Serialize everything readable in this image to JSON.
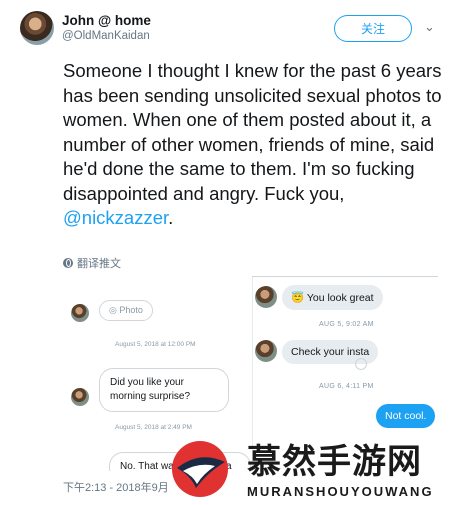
{
  "tweet": {
    "display_name": "John @ home",
    "handle": "@OldManKaidan",
    "follow_label": "关注",
    "chevron": "chevron-down-icon",
    "text_main": "Someone I thought I knew for the past 6 years has been sending unsolicited sexual photos to women. When one of them posted about it, a number of other women, friends of mine, said he'd done the same to them. I'm so fucking disappointed and angry. Fuck you, ",
    "mention": "@nickzazzer",
    "text_end": ".",
    "translate_label": "翻译推文",
    "timestamp": "下午2:13 - 2018年9月",
    "accent_color": "#1da1f2"
  },
  "media": {
    "left": {
      "photo_label": "Photo",
      "stamp1": "August 5, 2018 at 12:00 PM",
      "message1": "Did you like your morning surprise?",
      "stamp2": "August 5, 2018 at 2:49 PM",
      "message2": "No. That was inappropria"
    },
    "right": {
      "message1": "You look great",
      "message1_emoji": "😇",
      "stamp1": "AUG 5, 9:02 AM",
      "message2": "Check your insta",
      "stamp2": "AUG 6, 4:11 PM",
      "message3": "Not cool."
    }
  },
  "watermark": {
    "title": "慕然手游网",
    "subtitle": "MURANSHOUYOUWANG"
  }
}
